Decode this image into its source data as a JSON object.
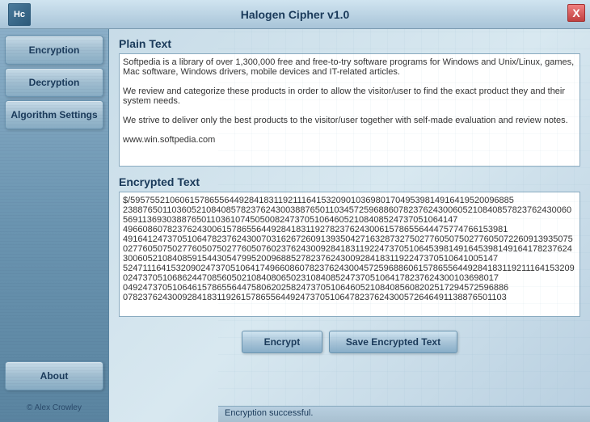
{
  "titlebar": {
    "logo": "Hc",
    "title": "Halogen Cipher v1.0",
    "close_label": "X"
  },
  "sidebar": {
    "buttons": [
      {
        "id": "encryption",
        "label": "Encryption"
      },
      {
        "id": "decryption",
        "label": "Decryption"
      },
      {
        "id": "algorithm_settings",
        "label": "Algorithm Settings"
      }
    ],
    "about_label": "About",
    "copyright": "© Alex Crowley"
  },
  "content": {
    "plain_text_label": "Plain Text",
    "plain_text_value": "Softpedia is a library of over 1,300,000 free and free-to-try software programs for Windows and Unix/Linux, games, Mac software, Windows drivers, mobile devices and IT-related articles.\n\nWe review and categorize these products in order to allow the visitor/user to find the exact product they and their system needs.\n\nWe strive to deliver only the best products to the visitor/user together with self-made evaluation and review notes.\n\nwww.win.softpedia.com",
    "encrypted_text_label": "Encrypted Text",
    "encrypted_text_value": "$/595755210606157865564492841831192111641532090103698017049539814916419520096885\n238876501103605210840857823762430038876501103457259688607823762430060521084085782376243006056911369303887650110361074505008247370510646052108408524737051064147\n496608607823762430061578655644928418311927823762430061578655644475774766153981\n491641247370510647823762430070316267260913935042716328732750277605075027760507226091393507502776050750277605075027760507602376243009284183119224737051064539814916453981491641782376243006052108408591544305479952009688527823762430092841831192247370510641005147\n524711164153209024737051064174966086078237624300457259688606157865564492841831192111641532090247370510686244708560502108408065023108408524737051064178237624300103698017\n049247370510646157865564475806202582473705106460521084085608202517294572596886\n078237624300928418311926157865564492473705106478237624300572646491138876501103",
    "buttons": {
      "encrypt_label": "Encrypt",
      "save_label": "Save Encrypted Text"
    },
    "status": "Encryption successful."
  }
}
